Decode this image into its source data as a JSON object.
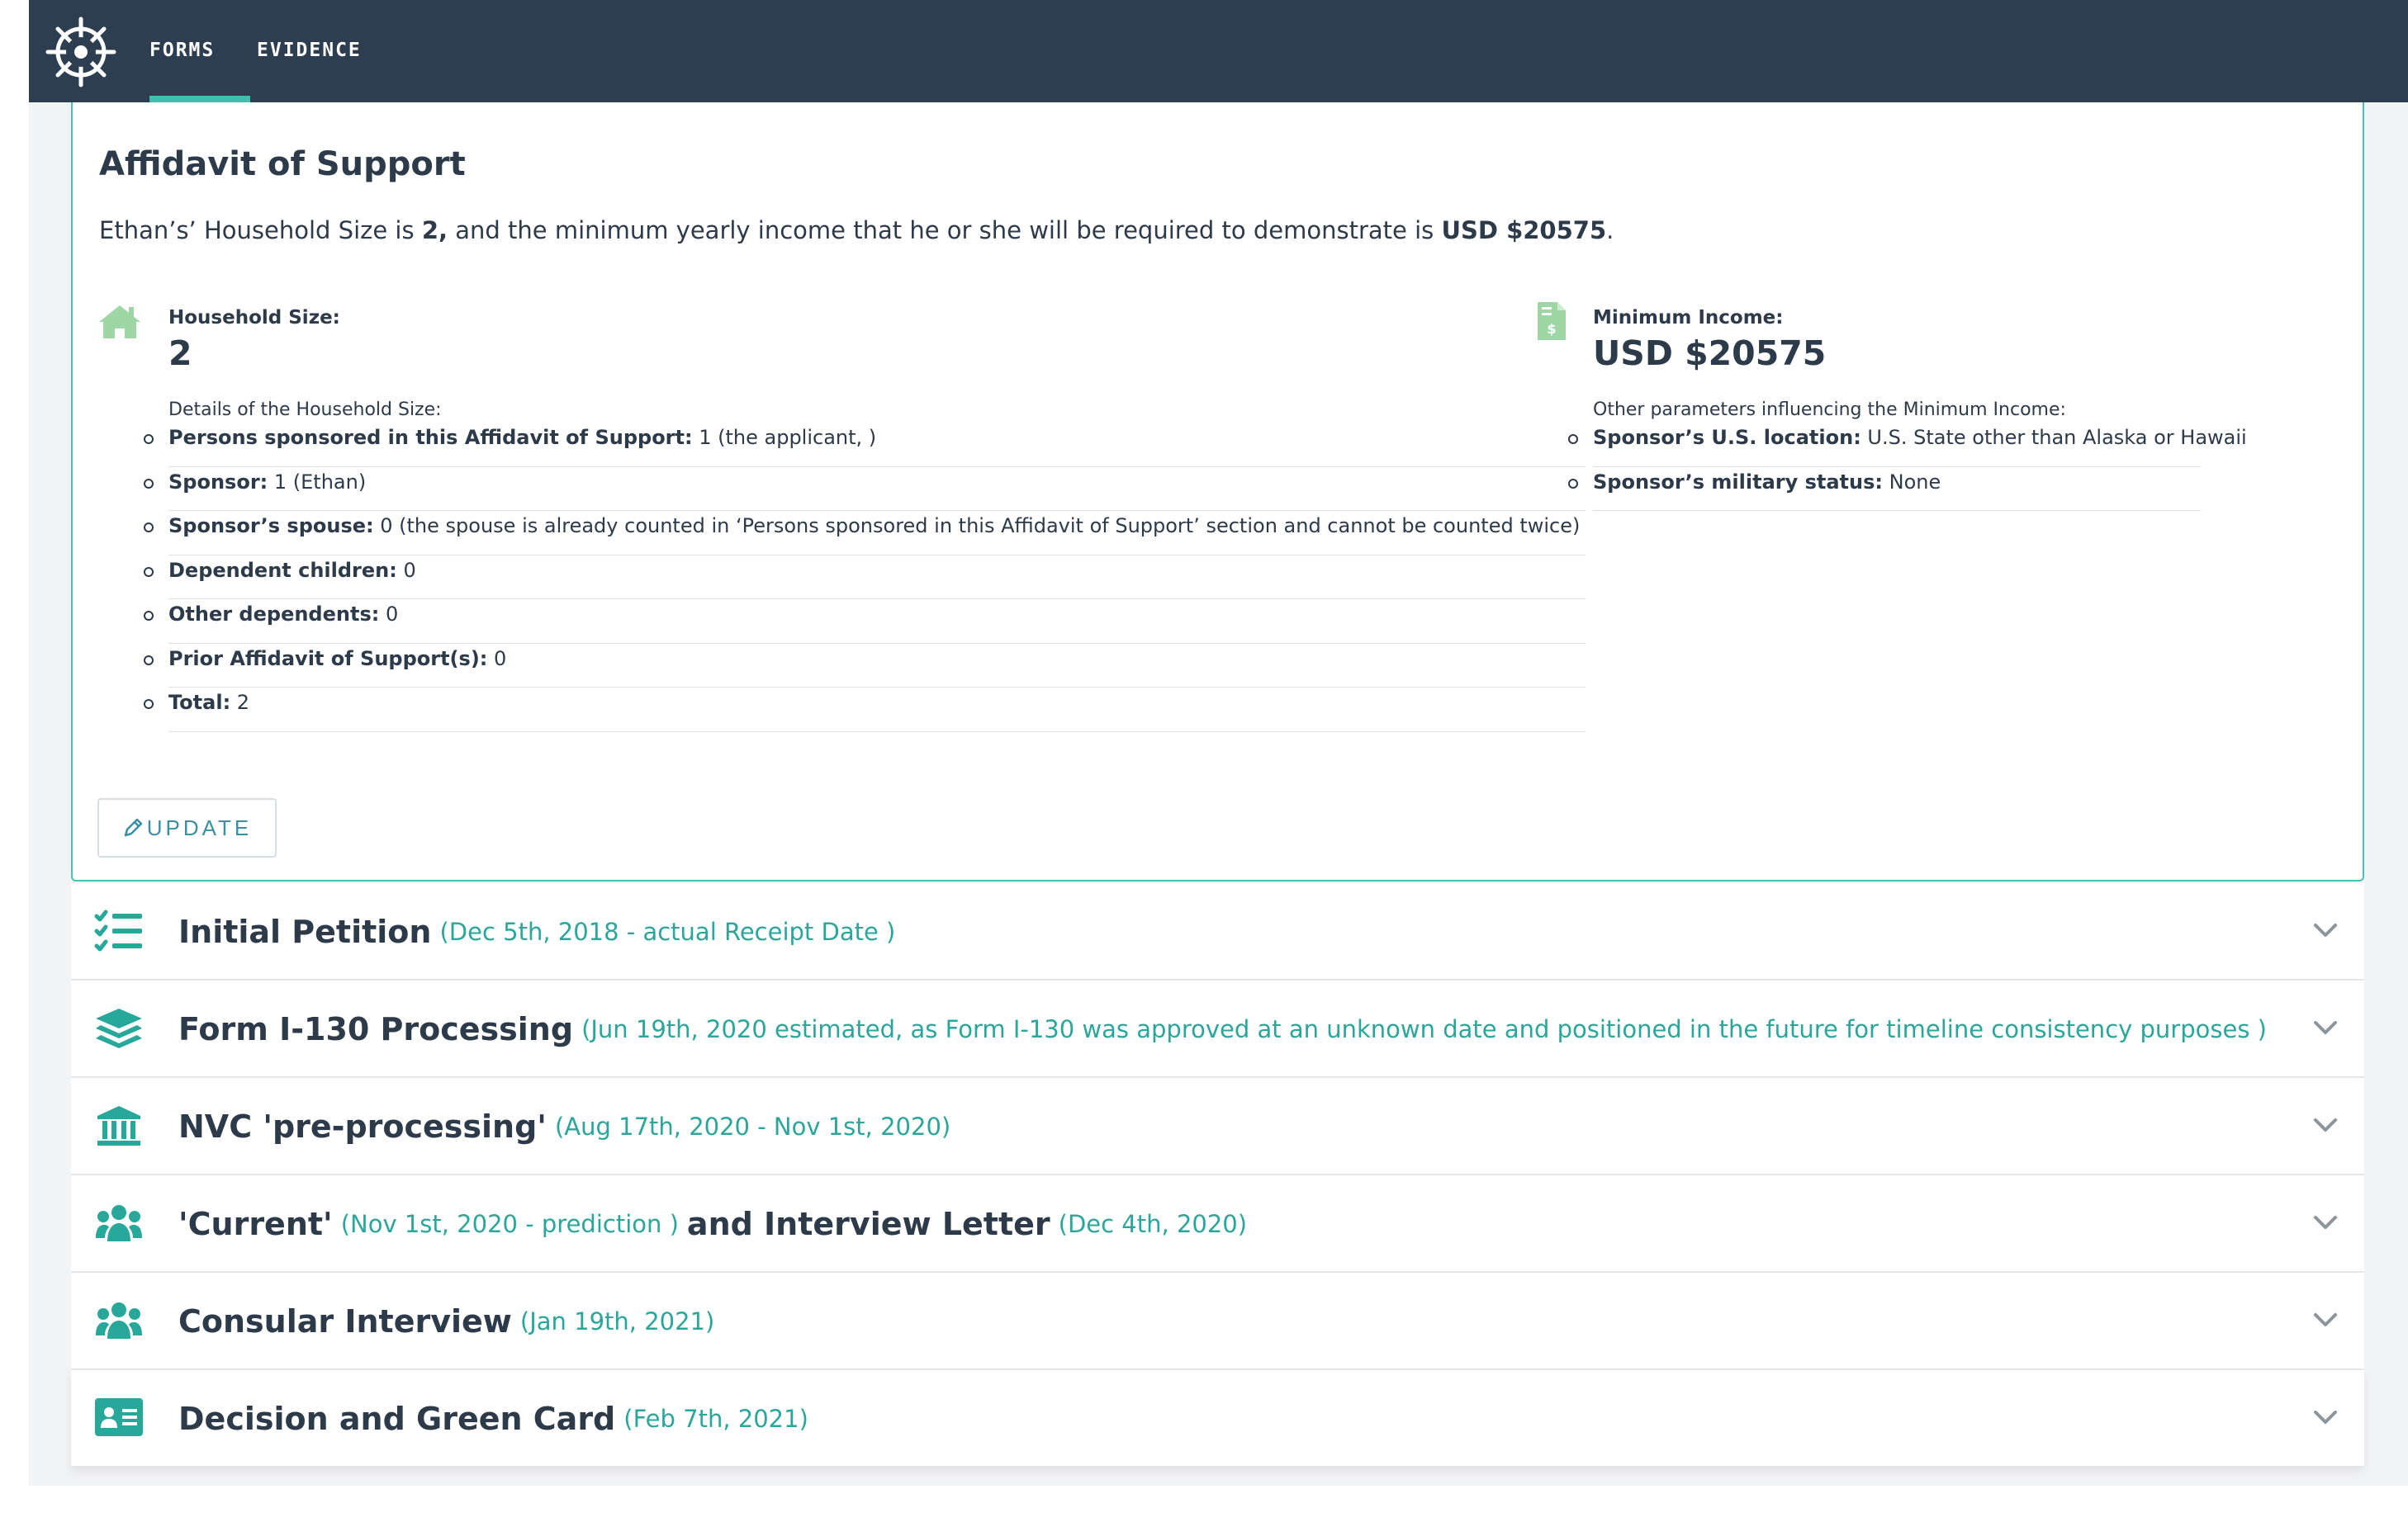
{
  "nav": {
    "tabs": [
      {
        "label": "FORMS",
        "active": true
      },
      {
        "label": "EVIDENCE",
        "active": false
      }
    ]
  },
  "affidavit": {
    "title": "Affidavit of Support",
    "summary_prefix": "Ethan’s’ Household Size is ",
    "summary_size": "2,",
    "summary_middle": " and the minimum yearly income that he or she will be required to demonstrate is ",
    "summary_income": "USD $20575",
    "summary_suffix": ".",
    "household": {
      "label": "Household Size:",
      "value": "2",
      "details_title": "Details of the Household Size:",
      "items": [
        {
          "key": "Persons sponsored in this Affidavit of Support:",
          "value": " 1 (the applicant, )"
        },
        {
          "key": "Sponsor:",
          "value": " 1 (Ethan)"
        },
        {
          "key": "Sponsor’s spouse:",
          "value": " 0 (the spouse is already counted in ‘Persons sponsored in this Affidavit of Support’ section and cannot be counted twice)"
        },
        {
          "key": "Dependent children:",
          "value": " 0"
        },
        {
          "key": "Other dependents:",
          "value": " 0"
        },
        {
          "key": "Prior Affidavit of Support(s):",
          "value": " 0"
        },
        {
          "key": "Total:",
          "value": " 2"
        }
      ]
    },
    "income": {
      "label": "Minimum Income:",
      "value": "USD $20575",
      "details_title": "Other parameters influencing the Minimum Income:",
      "items": [
        {
          "key": "Sponsor’s U.S. location:",
          "value": " U.S. State other than Alaska or Hawaii"
        },
        {
          "key": "Sponsor’s military status:",
          "value": " None"
        }
      ]
    },
    "update_label": "UPDATE"
  },
  "timeline": [
    {
      "icon": "checklist-icon",
      "parts": [
        {
          "t": "title",
          "v": "Initial Petition"
        },
        {
          "t": "date",
          "v": "(Dec 5th, 2018 - actual Receipt Date )"
        }
      ]
    },
    {
      "icon": "layers-icon",
      "parts": [
        {
          "t": "title",
          "v": "Form I-130 Processing"
        },
        {
          "t": "date",
          "v": "(Jun 19th, 2020 estimated, as Form I-130 was approved at an unknown date and positioned in the future for timeline consistency purposes )"
        }
      ]
    },
    {
      "icon": "bank-icon",
      "parts": [
        {
          "t": "title",
          "v": "NVC 'pre-processing'"
        },
        {
          "t": "date",
          "v": "(Aug 17th, 2020 - Nov 1st, 2020)"
        }
      ]
    },
    {
      "icon": "users-icon",
      "parts": [
        {
          "t": "title",
          "v": "'Current'"
        },
        {
          "t": "date",
          "v": "(Nov 1st, 2020 - prediction )"
        },
        {
          "t": "title",
          "v": "and Interview Letter"
        },
        {
          "t": "date",
          "v": "(Dec 4th, 2020)"
        }
      ]
    },
    {
      "icon": "users-icon",
      "parts": [
        {
          "t": "title",
          "v": "Consular Interview"
        },
        {
          "t": "date",
          "v": "(Jan 19th, 2021)"
        }
      ]
    },
    {
      "icon": "id-card-icon",
      "parts": [
        {
          "t": "title",
          "v": "Decision and Green Card"
        },
        {
          "t": "date",
          "v": "(Feb 7th, 2021)"
        }
      ]
    }
  ],
  "colors": {
    "nav_bg": "#2d3e50",
    "accent": "#45c4b0",
    "date_text": "#2aa79a",
    "icon_teal": "#27a89a",
    "icon_light_green": "#9fd6a6"
  }
}
